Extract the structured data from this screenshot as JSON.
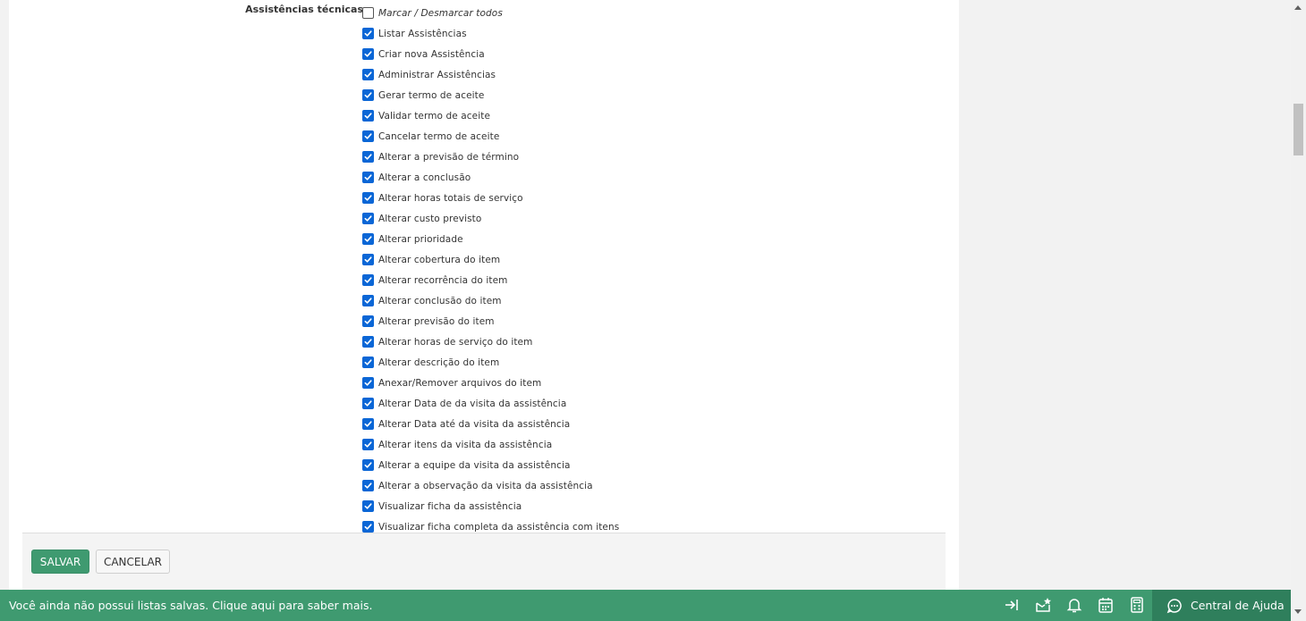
{
  "form": {
    "section_label": "Assistências técnicas",
    "toggle_all_label": "Marcar / Desmarcar todos",
    "permissions": [
      {
        "label": "Listar Assistências",
        "checked": true
      },
      {
        "label": "Criar nova Assistência",
        "checked": true
      },
      {
        "label": "Administrar Assistências",
        "checked": true
      },
      {
        "label": "Gerar termo de aceite",
        "checked": true
      },
      {
        "label": "Validar termo de aceite",
        "checked": true
      },
      {
        "label": "Cancelar termo de aceite",
        "checked": true
      },
      {
        "label": "Alterar a previsão de término",
        "checked": true
      },
      {
        "label": "Alterar a conclusão",
        "checked": true
      },
      {
        "label": "Alterar horas totais de serviço",
        "checked": true
      },
      {
        "label": "Alterar custo previsto",
        "checked": true
      },
      {
        "label": "Alterar prioridade",
        "checked": true
      },
      {
        "label": "Alterar cobertura do item",
        "checked": true
      },
      {
        "label": "Alterar recorrência do item",
        "checked": true
      },
      {
        "label": "Alterar conclusão do item",
        "checked": true
      },
      {
        "label": "Alterar previsão do item",
        "checked": true
      },
      {
        "label": "Alterar horas de serviço do item",
        "checked": true
      },
      {
        "label": "Alterar descrição do item",
        "checked": true
      },
      {
        "label": "Anexar/Remover arquivos do item",
        "checked": true
      },
      {
        "label": "Alterar Data de da visita da assistência",
        "checked": true
      },
      {
        "label": "Alterar Data até da visita da assistência",
        "checked": true
      },
      {
        "label": "Alterar itens da visita da assistência",
        "checked": true
      },
      {
        "label": "Alterar a equipe da visita da assistência",
        "checked": true
      },
      {
        "label": "Alterar a observação da visita da assistência",
        "checked": true
      },
      {
        "label": "Visualizar ficha da assistência",
        "checked": true
      },
      {
        "label": "Visualizar ficha completa da assistência com itens",
        "checked": true
      }
    ]
  },
  "actions": {
    "save_label": "SALVAR",
    "cancel_label": "CANCELAR"
  },
  "footer": {
    "message": "Você ainda não possui listas salvas. Clique aqui para saber mais.",
    "icons": [
      "collapse-arrow-icon",
      "message-star-icon",
      "bell-icon",
      "calendar-icon",
      "calculator-icon"
    ],
    "help_label": "Central de Ajuda",
    "color_primary": "#3f9a70",
    "color_help": "#2f7f5c"
  }
}
